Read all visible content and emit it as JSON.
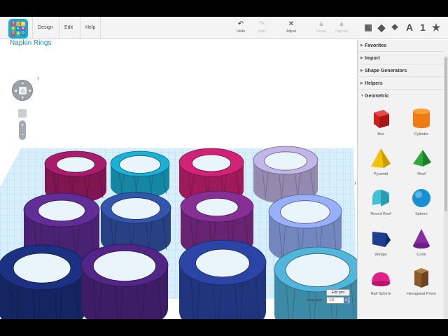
{
  "app": {
    "logo_letters": [
      "T",
      "I",
      "N",
      "K",
      "E",
      "R",
      "C",
      "A",
      "D"
    ],
    "menu": [
      "Design",
      "Edit",
      "Help"
    ]
  },
  "toolbar": {
    "undo": "Undo",
    "redo": "Redo",
    "adjust": "Adjust",
    "group": "Group",
    "ungroup": "Ungroup",
    "view_text": "A",
    "view_number": "1"
  },
  "workplane": {
    "title": "Napkin Rings",
    "nav_help": "?",
    "zoom_in": "+",
    "zoom_out": "−",
    "edit_grid": "Edit grid",
    "snap_grid_label": "Snap grid",
    "snap_grid_value": "1.0"
  },
  "panel": {
    "sections": [
      "Favorites",
      "Import",
      "Shape Generators",
      "Helpers",
      "Geometric"
    ],
    "shapes": [
      "Box",
      "Cylinder",
      "Pyramid",
      "Roof",
      "Round Roof",
      "Sphere",
      "Wedge",
      "Cone",
      "Half Sphere",
      "Hexagonal Prism"
    ]
  },
  "colors": {
    "accent": "#1e8fc1",
    "grid": "#a7d8ef",
    "rings": [
      "#9b1a63",
      "#19a3c7",
      "#c1206e",
      "#b4a8d6",
      "#5a2a8c",
      "#2f4fa0",
      "#7c2c8a",
      "#8da3e8",
      "#1a2d77",
      "#4c237d",
      "#28409a",
      "#4ba8cc"
    ]
  }
}
